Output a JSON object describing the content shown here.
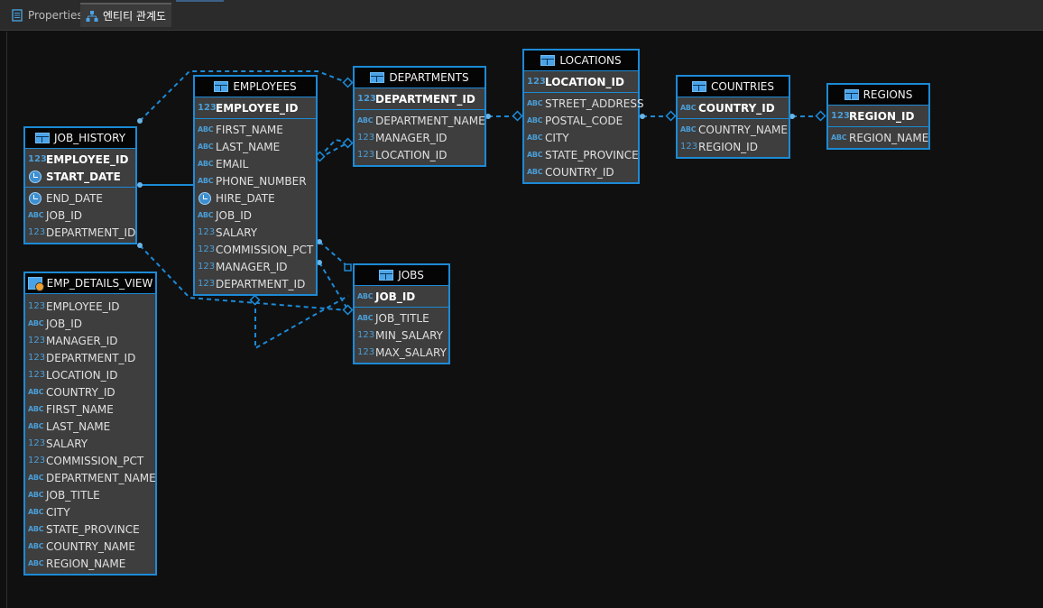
{
  "tabs": [
    {
      "label": "Properties",
      "icon": "properties-icon",
      "active": false
    },
    {
      "label": "엔티티 관계도",
      "icon": "er-diagram-icon",
      "active": true
    }
  ],
  "type_icons": {
    "num": "123",
    "str": "ABC",
    "date": "clock-icon"
  },
  "colors": {
    "accent": "#1c8ad6",
    "background": "#101010",
    "entity_fill": "#3e3e3e",
    "header": "#050505"
  },
  "entities": {
    "employees": {
      "name": "EMPLOYEES",
      "pk": [
        {
          "name": "EMPLOYEE_ID",
          "type": "123"
        }
      ],
      "cols": [
        {
          "name": "FIRST_NAME",
          "type": "ABC"
        },
        {
          "name": "LAST_NAME",
          "type": "ABC"
        },
        {
          "name": "EMAIL",
          "type": "ABC"
        },
        {
          "name": "PHONE_NUMBER",
          "type": "ABC"
        },
        {
          "name": "HIRE_DATE",
          "type": "date"
        },
        {
          "name": "JOB_ID",
          "type": "ABC"
        },
        {
          "name": "SALARY",
          "type": "123"
        },
        {
          "name": "COMMISSION_PCT",
          "type": "123"
        },
        {
          "name": "MANAGER_ID",
          "type": "123"
        },
        {
          "name": "DEPARTMENT_ID",
          "type": "123"
        }
      ]
    },
    "departments": {
      "name": "DEPARTMENTS",
      "pk": [
        {
          "name": "DEPARTMENT_ID",
          "type": "123"
        }
      ],
      "cols": [
        {
          "name": "DEPARTMENT_NAME",
          "type": "ABC"
        },
        {
          "name": "MANAGER_ID",
          "type": "123"
        },
        {
          "name": "LOCATION_ID",
          "type": "123"
        }
      ]
    },
    "locations": {
      "name": "LOCATIONS",
      "pk": [
        {
          "name": "LOCATION_ID",
          "type": "123"
        }
      ],
      "cols": [
        {
          "name": "STREET_ADDRESS",
          "type": "ABC"
        },
        {
          "name": "POSTAL_CODE",
          "type": "ABC"
        },
        {
          "name": "CITY",
          "type": "ABC"
        },
        {
          "name": "STATE_PROVINCE",
          "type": "ABC"
        },
        {
          "name": "COUNTRY_ID",
          "type": "ABC"
        }
      ]
    },
    "countries": {
      "name": "COUNTRIES",
      "pk": [
        {
          "name": "COUNTRY_ID",
          "type": "ABC"
        }
      ],
      "cols": [
        {
          "name": "COUNTRY_NAME",
          "type": "ABC"
        },
        {
          "name": "REGION_ID",
          "type": "123"
        }
      ]
    },
    "regions": {
      "name": "REGIONS",
      "pk": [
        {
          "name": "REGION_ID",
          "type": "123"
        }
      ],
      "cols": [
        {
          "name": "REGION_NAME",
          "type": "ABC"
        }
      ]
    },
    "job_history": {
      "name": "JOB_HISTORY",
      "pk": [
        {
          "name": "EMPLOYEE_ID",
          "type": "123"
        },
        {
          "name": "START_DATE",
          "type": "date"
        }
      ],
      "cols": [
        {
          "name": "END_DATE",
          "type": "date"
        },
        {
          "name": "JOB_ID",
          "type": "ABC"
        },
        {
          "name": "DEPARTMENT_ID",
          "type": "123"
        }
      ]
    },
    "jobs": {
      "name": "JOBS",
      "pk": [
        {
          "name": "JOB_ID",
          "type": "ABC"
        }
      ],
      "cols": [
        {
          "name": "JOB_TITLE",
          "type": "ABC"
        },
        {
          "name": "MIN_SALARY",
          "type": "123"
        },
        {
          "name": "MAX_SALARY",
          "type": "123"
        }
      ]
    },
    "emp_details_view": {
      "name": "EMP_DETAILS_VIEW",
      "pk": [],
      "cols": [
        {
          "name": "EMPLOYEE_ID",
          "type": "123"
        },
        {
          "name": "JOB_ID",
          "type": "ABC"
        },
        {
          "name": "MANAGER_ID",
          "type": "123"
        },
        {
          "name": "DEPARTMENT_ID",
          "type": "123"
        },
        {
          "name": "LOCATION_ID",
          "type": "123"
        },
        {
          "name": "COUNTRY_ID",
          "type": "ABC"
        },
        {
          "name": "FIRST_NAME",
          "type": "ABC"
        },
        {
          "name": "LAST_NAME",
          "type": "ABC"
        },
        {
          "name": "SALARY",
          "type": "123"
        },
        {
          "name": "COMMISSION_PCT",
          "type": "123"
        },
        {
          "name": "DEPARTMENT_NAME",
          "type": "ABC"
        },
        {
          "name": "JOB_TITLE",
          "type": "ABC"
        },
        {
          "name": "CITY",
          "type": "ABC"
        },
        {
          "name": "STATE_PROVINCE",
          "type": "ABC"
        },
        {
          "name": "COUNTRY_NAME",
          "type": "ABC"
        },
        {
          "name": "REGION_NAME",
          "type": "ABC"
        }
      ]
    }
  }
}
